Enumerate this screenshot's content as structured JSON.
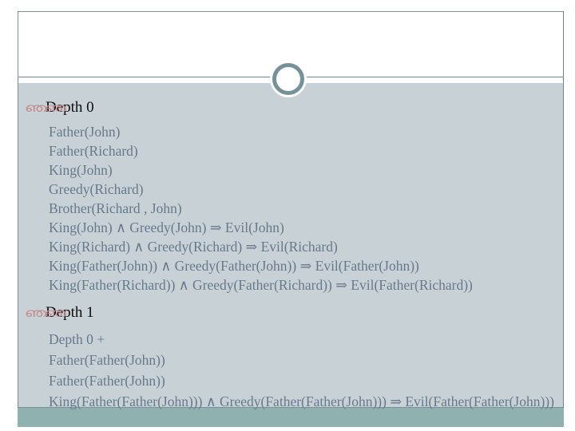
{
  "slide": {
    "bullet_glyph": "ഞഞ",
    "colors": {
      "panel_background": "#c7d1d6",
      "body_text": "#67798c",
      "heading_text": "#0d0d0d",
      "bullet": "#c48a8a",
      "frame_border": "#7b8f96",
      "ring_ornament": "#77919a",
      "footer_band": "#8fb2b0"
    },
    "ornaments": {
      "ring": "ring-ornament",
      "header_rule": "header-divider-rule",
      "footer": "footer-band"
    },
    "sections": [
      {
        "title": "Depth 0",
        "clauses": [
          "Father(John)",
          "Father(Richard)",
          "King(John)",
          "Greedy(Richard)",
          "Brother(Richard , John)",
          "King(John) ∧ Greedy(John) ⇒ Evil(John)",
          "King(Richard) ∧ Greedy(Richard) ⇒ Evil(Richard)",
          "King(Father(John)) ∧ Greedy(Father(John)) ⇒ Evil(Father(John))",
          "King(Father(Richard)) ∧ Greedy(Father(Richard)) ⇒ Evil(Father(Richard))"
        ]
      },
      {
        "title": "Depth 1",
        "clauses": [
          "Depth 0 +",
          "Father(Father(John))",
          "Father(Father(John))",
          "King(Father(Father(John))) ∧ Greedy(Father(Father(John))) ⇒ Evil(Father(Father(John)))"
        ]
      }
    ]
  }
}
